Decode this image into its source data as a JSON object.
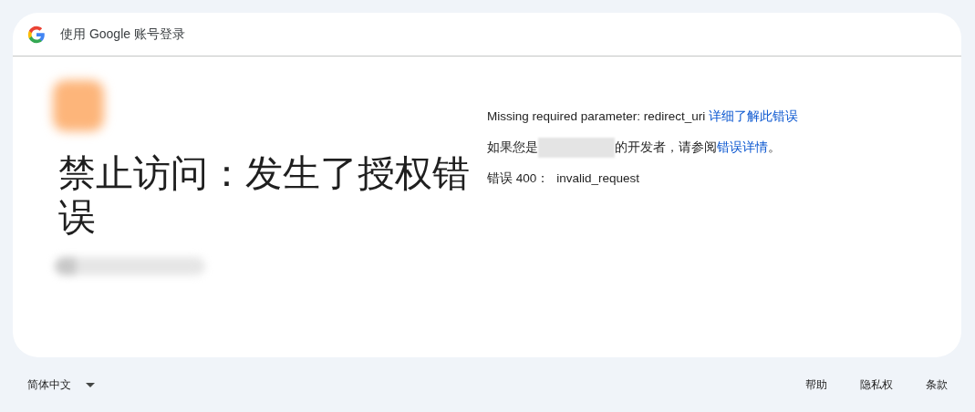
{
  "header": {
    "title": "使用 Google 账号登录"
  },
  "heading": "禁止访问：发生了授权错误",
  "details": [
    {
      "text": "Missing required parameter: redirect_uri ",
      "link": "详细了解此错误"
    },
    {
      "before": "如果您是",
      "text": "的开发者，请参阅",
      "link": "错误详情",
      "after": "。"
    }
  ],
  "error": {
    "label": "错误 400：",
    "code": "invalid_request"
  },
  "footer": {
    "language": "简体中文",
    "links": [
      "帮助",
      "隐私权",
      "条款"
    ]
  }
}
